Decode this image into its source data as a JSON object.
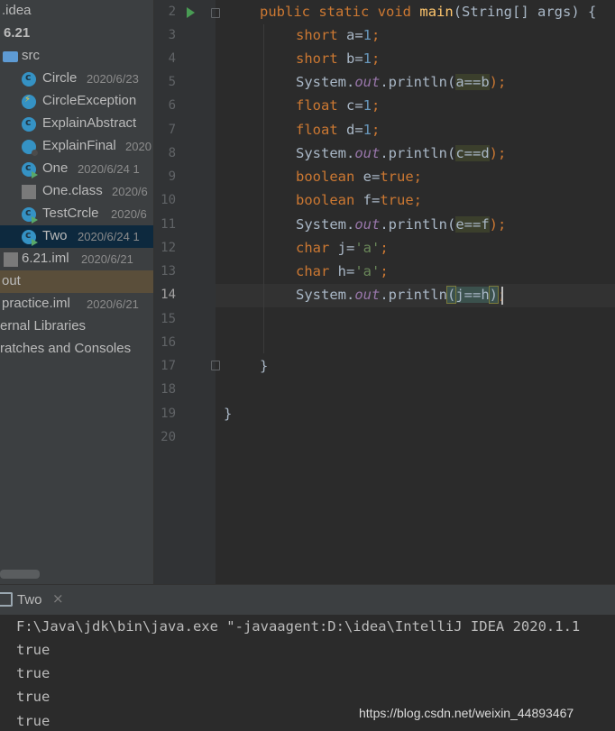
{
  "project_tree": {
    "rows": [
      {
        "label": ".idea",
        "date": ""
      },
      {
        "label": "6.21",
        "date": ""
      },
      {
        "label": "src",
        "date": ""
      },
      {
        "label": "Circle",
        "date": "2020/6/23"
      },
      {
        "label": "CircleException",
        "date": ""
      },
      {
        "label": "ExplainAbstract",
        "date": ""
      },
      {
        "label": "ExplainFinal",
        "date": "2020"
      },
      {
        "label": "One",
        "date": "2020/6/24 1"
      },
      {
        "label": "One.class",
        "date": "2020/6"
      },
      {
        "label": "TestCrcle",
        "date": "2020/6"
      },
      {
        "label": "Two",
        "date": "2020/6/24 1"
      },
      {
        "label": "6.21.iml",
        "date": "2020/6/21"
      },
      {
        "label": "out",
        "date": ""
      },
      {
        "label": "practice.iml",
        "date": "2020/6/21"
      },
      {
        "label": "ernal Libraries",
        "date": ""
      },
      {
        "label": "ratches and Consoles",
        "date": ""
      }
    ],
    "selected_item": "Two"
  },
  "editor": {
    "line_numbers": [
      "2",
      "3",
      "4",
      "5",
      "6",
      "7",
      "8",
      "9",
      "10",
      "11",
      "12",
      "13",
      "14",
      "15",
      "16",
      "17",
      "18",
      "19",
      "20"
    ],
    "current_line": "14",
    "code": {
      "l2": {
        "kw1": "public",
        "kw2": "static",
        "kw3": "void",
        "name": "main",
        "rest": "(String[] args) {"
      },
      "l3": {
        "type": "short",
        "decl": " a=",
        "val": "1",
        "end": ";"
      },
      "l4": {
        "type": "short",
        "decl": " b=",
        "val": "1",
        "end": ";"
      },
      "l5": {
        "obj": "System.",
        "field": "out",
        "call": ".println(",
        "expr": "a==b",
        "end": ");"
      },
      "l6": {
        "type": "float",
        "decl": " c=",
        "val": "1",
        "end": ";"
      },
      "l7": {
        "type": "float",
        "decl": " d=",
        "val": "1",
        "end": ";"
      },
      "l8": {
        "obj": "System.",
        "field": "out",
        "call": ".println(",
        "expr": "c==d",
        "end": ");"
      },
      "l9": {
        "type": "boolean",
        "decl": " e=",
        "val": "true",
        "end": ";"
      },
      "l10": {
        "type": "boolean",
        "decl": " f=",
        "val": "true",
        "end": ";"
      },
      "l11": {
        "obj": "System.",
        "field": "out",
        "call": ".println(",
        "expr": "e==f",
        "end": ");"
      },
      "l12": {
        "type": "char",
        "decl": " j=",
        "val": "'a'",
        "end": ";"
      },
      "l13": {
        "type": "char",
        "decl": " h=",
        "val": "'a'",
        "end": ";"
      },
      "l14": {
        "obj": "System.",
        "field": "out",
        "call": ".println",
        "open": "(",
        "expr": "j==h",
        "close": ")",
        "end": ";"
      },
      "l17": {
        "brace": "}"
      },
      "l19": {
        "brace": "}"
      }
    }
  },
  "run_panel": {
    "tab_label": "Two",
    "close_glyph": "×",
    "lines": [
      "F:\\Java\\jdk\\bin\\java.exe \"-javaagent:D:\\idea\\IntelliJ IDEA 2020.1.1",
      "true",
      "true",
      "true",
      "true"
    ]
  },
  "watermark": "https://blog.csdn.net/weixin_44893467",
  "colors": {
    "keyword": "#cc7832",
    "number": "#6897bb",
    "string": "#6a8759",
    "field": "#9876aa",
    "method": "#ffc66d",
    "text": "#a9b7c6",
    "selection": "#0d293e"
  }
}
